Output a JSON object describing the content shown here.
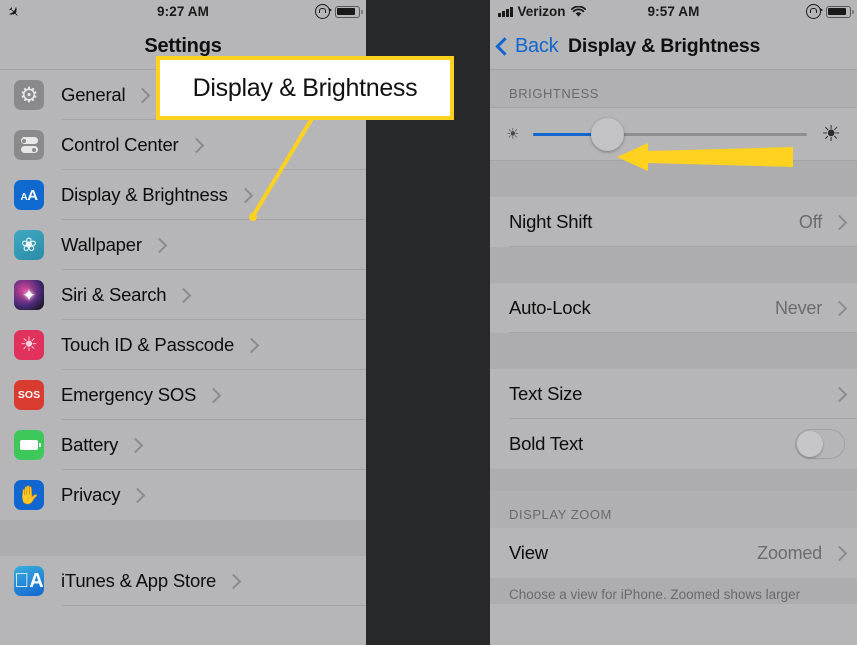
{
  "annotation": {
    "callout_label": "Display & Brightness",
    "callout_border_color": "#ffd21f",
    "arrow_color": "#ffd21f",
    "pointer_line_color": "#ffd21f"
  },
  "left_phone": {
    "status_bar": {
      "airplane_icon": "airplane-mode-icon",
      "time": "9:27 AM",
      "rotation_lock_icon": "rotation-lock-icon",
      "battery_icon": "battery-icon"
    },
    "nav": {
      "title": "Settings"
    },
    "groups": [
      {
        "items": [
          {
            "label": "General",
            "icon": "gear-icon",
            "chevron": true
          },
          {
            "label": "Control Center",
            "icon": "toggles-icon",
            "chevron": true
          },
          {
            "label": "Display & Brightness",
            "icon": "aa-text-icon",
            "chevron": true
          },
          {
            "label": "Wallpaper",
            "icon": "flower-icon",
            "chevron": true
          },
          {
            "label": "Siri & Search",
            "icon": "siri-icon",
            "chevron": true
          },
          {
            "label": "Touch ID & Passcode",
            "icon": "fingerprint-icon",
            "chevron": true
          },
          {
            "label": "Emergency SOS",
            "icon": "sos-icon",
            "chevron": true
          },
          {
            "label": "Battery",
            "icon": "battery-icon",
            "chevron": true
          },
          {
            "label": "Privacy",
            "icon": "hand-icon",
            "chevron": true
          }
        ]
      },
      {
        "items": [
          {
            "label": "iTunes & App Store",
            "icon": "app-store-icon",
            "chevron": true
          }
        ]
      }
    ]
  },
  "right_phone": {
    "status_bar": {
      "signal_icon": "signal-bars-icon",
      "carrier": "Verizon",
      "wifi_icon": "wifi-icon",
      "time": "9:57 AM",
      "rotation_lock_icon": "rotation-lock-icon",
      "battery_icon": "battery-icon"
    },
    "nav": {
      "back_label": "Back",
      "title": "Display & Brightness"
    },
    "brightness": {
      "section_header": "BRIGHTNESS",
      "low_icon": "sun-small-icon",
      "high_icon": "sun-large-icon",
      "value_percent": 27,
      "fill_color": "#1266cf"
    },
    "rows": [
      {
        "label": "Night Shift",
        "value": "Off",
        "control": "chevron"
      },
      {
        "label": "Auto-Lock",
        "value": "Never",
        "control": "chevron"
      },
      {
        "label": "Text Size",
        "value": "",
        "control": "chevron"
      },
      {
        "label": "Bold Text",
        "value": "",
        "control": "toggle",
        "toggle_on": false
      }
    ],
    "display_zoom": {
      "section_header": "DISPLAY ZOOM",
      "view_label": "View",
      "view_value": "Zoomed",
      "footnote": "Choose a view for iPhone. Zoomed shows larger"
    }
  }
}
